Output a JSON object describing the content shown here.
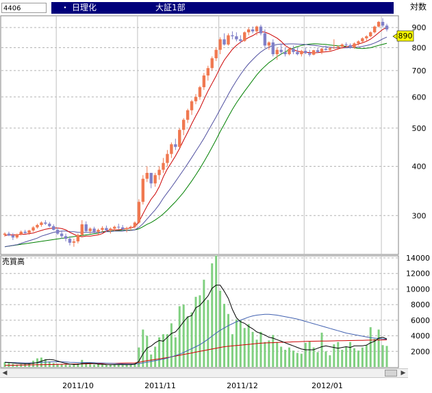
{
  "header": {
    "code": "4406",
    "bullet": "・",
    "company": "日理化",
    "market": "大証1部",
    "period": "対数"
  },
  "price_panel": {
    "current_price": "890",
    "y_ticks": [
      "900",
      "800",
      "700",
      "600",
      "500",
      "400",
      "300"
    ]
  },
  "volume_panel": {
    "label": "売買高",
    "y_ticks": [
      "14000",
      "12000",
      "10000",
      "8000",
      "6000",
      "4000",
      "2000"
    ]
  },
  "x_ticks": [
    "2011/10",
    "2011/11",
    "2011/12",
    "2012/01"
  ],
  "colors": {
    "up": "#f07850",
    "down": "#8080c8",
    "ma_short": "#cc0000",
    "ma_mid": "#5050a0",
    "ma_long": "#008000",
    "vol_bar": "#80d080",
    "vol_ma_short": "#000000",
    "vol_ma_mid": "#4060b0",
    "vol_ma_long": "#cc0000",
    "price_tag": "#ffff00"
  },
  "chart_data": {
    "type": "candlestick",
    "scale": "log",
    "x": [
      "2011-09-12",
      "2011-09-13",
      "2011-09-14",
      "2011-09-15",
      "2011-09-16",
      "2011-09-20",
      "2011-09-21",
      "2011-09-22",
      "2011-09-26",
      "2011-09-27",
      "2011-09-28",
      "2011-09-29",
      "2011-09-30",
      "2011-10-03",
      "2011-10-04",
      "2011-10-05",
      "2011-10-06",
      "2011-10-07",
      "2011-10-11",
      "2011-10-12",
      "2011-10-13",
      "2011-10-14",
      "2011-10-17",
      "2011-10-18",
      "2011-10-19",
      "2011-10-20",
      "2011-10-21",
      "2011-10-24",
      "2011-10-25",
      "2011-10-26",
      "2011-10-27",
      "2011-10-28",
      "2011-10-31",
      "2011-11-01",
      "2011-11-02",
      "2011-11-04",
      "2011-11-07",
      "2011-11-08",
      "2011-11-09",
      "2011-11-10",
      "2011-11-11",
      "2011-11-14",
      "2011-11-15",
      "2011-11-16",
      "2011-11-17",
      "2011-11-18",
      "2011-11-21",
      "2011-11-22",
      "2011-11-24",
      "2011-11-25",
      "2011-11-28",
      "2011-11-29",
      "2011-11-30",
      "2011-12-01",
      "2011-12-02",
      "2011-12-05",
      "2011-12-06",
      "2011-12-07",
      "2011-12-08",
      "2011-12-09",
      "2011-12-12",
      "2011-12-13",
      "2011-12-14",
      "2011-12-15",
      "2011-12-16",
      "2011-12-19",
      "2011-12-20",
      "2011-12-21",
      "2011-12-22",
      "2011-12-26",
      "2011-12-27",
      "2011-12-28",
      "2011-12-29",
      "2011-12-30",
      "2012-01-04",
      "2012-01-05",
      "2012-01-06",
      "2012-01-10",
      "2012-01-11",
      "2012-01-12",
      "2012-01-13",
      "2012-01-16",
      "2012-01-17",
      "2012-01-18",
      "2012-01-19",
      "2012-01-20",
      "2012-01-23",
      "2012-01-24",
      "2012-01-25",
      "2012-01-26",
      "2012-01-27",
      "2012-01-30",
      "2012-01-31",
      "2012-02-01",
      "2012-02-02"
    ],
    "ohlc": [
      [
        268,
        272,
        265,
        270
      ],
      [
        270,
        273,
        266,
        267
      ],
      [
        267,
        271,
        260,
        264
      ],
      [
        264,
        270,
        262,
        269
      ],
      [
        269,
        275,
        267,
        273
      ],
      [
        273,
        276,
        270,
        271
      ],
      [
        271,
        276,
        268,
        275
      ],
      [
        275,
        282,
        273,
        280
      ],
      [
        280,
        286,
        278,
        284
      ],
      [
        284,
        290,
        281,
        288
      ],
      [
        288,
        292,
        284,
        286
      ],
      [
        286,
        289,
        280,
        282
      ],
      [
        282,
        285,
        275,
        276
      ],
      [
        276,
        280,
        268,
        270
      ],
      [
        270,
        275,
        262,
        266
      ],
      [
        266,
        270,
        258,
        262
      ],
      [
        262,
        266,
        252,
        256
      ],
      [
        256,
        262,
        250,
        258
      ],
      [
        258,
        270,
        255,
        268
      ],
      [
        268,
        292,
        266,
        285
      ],
      [
        285,
        290,
        272,
        274
      ],
      [
        274,
        280,
        270,
        278
      ],
      [
        278,
        281,
        270,
        273
      ],
      [
        273,
        278,
        268,
        276
      ],
      [
        276,
        282,
        272,
        279
      ],
      [
        279,
        283,
        273,
        275
      ],
      [
        275,
        280,
        270,
        278
      ],
      [
        278,
        283,
        274,
        281
      ],
      [
        281,
        286,
        277,
        280
      ],
      [
        280,
        284,
        274,
        277
      ],
      [
        277,
        281,
        272,
        279
      ],
      [
        279,
        283,
        275,
        281
      ],
      [
        281,
        290,
        278,
        288
      ],
      [
        288,
        330,
        286,
        325
      ],
      [
        325,
        380,
        320,
        372
      ],
      [
        372,
        400,
        365,
        385
      ],
      [
        385,
        380,
        352,
        362
      ],
      [
        362,
        385,
        355,
        380
      ],
      [
        380,
        400,
        370,
        392
      ],
      [
        392,
        420,
        385,
        408
      ],
      [
        408,
        440,
        400,
        430
      ],
      [
        430,
        460,
        420,
        455
      ],
      [
        455,
        470,
        440,
        448
      ],
      [
        448,
        500,
        445,
        495
      ],
      [
        495,
        530,
        480,
        525
      ],
      [
        525,
        560,
        515,
        555
      ],
      [
        555,
        590,
        540,
        585
      ],
      [
        585,
        610,
        575,
        600
      ],
      [
        600,
        640,
        590,
        635
      ],
      [
        635,
        690,
        625,
        680
      ],
      [
        680,
        720,
        660,
        710
      ],
      [
        710,
        760,
        700,
        752
      ],
      [
        752,
        800,
        740,
        790
      ],
      [
        790,
        850,
        770,
        840
      ],
      [
        840,
        870,
        810,
        815
      ],
      [
        815,
        870,
        810,
        860
      ],
      [
        860,
        880,
        840,
        855
      ],
      [
        855,
        875,
        830,
        840
      ],
      [
        840,
        860,
        820,
        832
      ],
      [
        832,
        880,
        828,
        875
      ],
      [
        875,
        900,
        860,
        890
      ],
      [
        890,
        905,
        870,
        880
      ],
      [
        880,
        910,
        860,
        905
      ],
      [
        905,
        915,
        860,
        870
      ],
      [
        870,
        890,
        800,
        810
      ],
      [
        810,
        830,
        790,
        825
      ],
      [
        825,
        840,
        760,
        770
      ],
      [
        770,
        800,
        745,
        790
      ],
      [
        790,
        815,
        770,
        780
      ],
      [
        780,
        800,
        760,
        770
      ],
      [
        770,
        800,
        765,
        795
      ],
      [
        795,
        810,
        770,
        780
      ],
      [
        780,
        800,
        765,
        770
      ],
      [
        770,
        790,
        760,
        785
      ],
      [
        785,
        800,
        770,
        775
      ],
      [
        775,
        790,
        760,
        768
      ],
      [
        768,
        790,
        765,
        788
      ],
      [
        788,
        800,
        775,
        780
      ],
      [
        780,
        800,
        770,
        795
      ],
      [
        795,
        810,
        785,
        790
      ],
      [
        790,
        805,
        780,
        798
      ],
      [
        798,
        840,
        795,
        800
      ],
      [
        800,
        810,
        790,
        805
      ],
      [
        805,
        820,
        795,
        815
      ],
      [
        815,
        825,
        805,
        812
      ],
      [
        812,
        820,
        795,
        800
      ],
      [
        800,
        825,
        795,
        820
      ],
      [
        820,
        835,
        810,
        830
      ],
      [
        830,
        850,
        820,
        845
      ],
      [
        845,
        860,
        830,
        855
      ],
      [
        855,
        880,
        850,
        875
      ],
      [
        875,
        910,
        870,
        905
      ],
      [
        905,
        935,
        900,
        930
      ],
      [
        930,
        950,
        900,
        910
      ],
      [
        910,
        920,
        880,
        890
      ]
    ],
    "volume": [
      600,
      500,
      400,
      300,
      350,
      400,
      500,
      800,
      1100,
      1200,
      1000,
      700,
      500,
      400,
      350,
      300,
      250,
      300,
      450,
      900,
      400,
      350,
      300,
      350,
      300,
      250,
      300,
      350,
      300,
      250,
      300,
      350,
      500,
      2500,
      4800,
      4000,
      1600,
      2600,
      3800,
      4200,
      4200,
      5600,
      3800,
      7800,
      8000,
      6500,
      7000,
      9000,
      9200,
      11200,
      8600,
      13300,
      14300,
      9800,
      8100,
      6800,
      4200,
      6100,
      6000,
      5000,
      5500,
      4500,
      3500,
      4500,
      3200,
      3400,
      4100,
      3200,
      2600,
      2200,
      2500,
      2100,
      1800,
      1700,
      3100,
      3300,
      2500,
      1900,
      4400,
      2000,
      1500,
      2900,
      3200,
      2200,
      2600,
      3200,
      2400,
      2100,
      2500,
      2800,
      5100,
      3600,
      4800,
      2800,
      2700
    ],
    "ma": {
      "short": [
        267,
        268,
        268,
        268,
        269,
        269,
        270,
        271,
        273,
        275,
        277,
        278,
        279,
        279,
        278,
        276,
        272,
        269,
        266,
        265,
        266,
        266,
        267,
        268,
        270,
        274,
        276,
        276,
        276,
        277,
        278,
        279,
        281,
        289,
        303,
        317,
        330,
        340,
        355,
        376,
        394,
        409,
        425,
        444,
        466,
        488,
        513,
        537,
        561,
        591,
        621,
        649,
        678,
        713,
        744,
        768,
        792,
        811,
        826,
        837,
        849,
        858,
        871,
        878,
        876,
        868,
        857,
        846,
        830,
        810,
        798,
        790,
        784,
        780,
        778,
        778,
        776,
        777,
        779,
        781,
        783,
        788,
        795,
        800,
        804,
        807,
        811,
        817,
        823,
        830,
        841,
        856,
        873,
        890,
        900
      ],
      "mid": [
        250,
        251,
        252,
        253,
        255,
        257,
        259,
        261,
        263,
        266,
        268,
        270,
        272,
        273,
        274,
        274,
        273,
        273,
        272,
        272,
        272,
        272,
        272,
        272,
        272,
        273,
        273,
        274,
        274,
        274,
        275,
        275,
        276,
        280,
        286,
        294,
        302,
        310,
        320,
        332,
        343,
        354,
        366,
        379,
        392,
        406,
        421,
        437,
        453,
        471,
        491,
        512,
        534,
        558,
        583,
        609,
        635,
        660,
        684,
        707,
        728,
        746,
        764,
        780,
        793,
        803,
        810,
        815,
        817,
        817,
        818,
        818,
        817,
        816,
        815,
        813,
        811,
        809,
        806,
        804,
        802,
        800,
        799,
        799,
        799,
        800,
        801,
        803,
        806,
        810,
        815,
        822,
        831,
        842,
        851
      ]
    },
    "volume_ma": {
      "short": [
        600,
        560,
        520,
        470,
        440,
        410,
        420,
        480,
        560,
        740,
        900,
        960,
        900,
        760,
        600,
        460,
        360,
        320,
        330,
        440,
        460,
        480,
        440,
        360,
        340,
        300,
        290,
        300,
        300,
        300,
        290,
        300,
        340,
        740,
        1680,
        2420,
        2680,
        3100,
        3400,
        3300,
        3800,
        4300,
        4500,
        5100,
        5800,
        6400,
        6600,
        7600,
        7900,
        8500,
        9100,
        10100,
        10500,
        10500,
        9700,
        8800,
        7400,
        6300,
        5800,
        5600,
        5200,
        4900,
        4500,
        4300,
        4100,
        3800,
        3700,
        3500,
        3300,
        3100,
        2900,
        2700,
        2500,
        2300,
        2200,
        2200,
        2200,
        2400,
        2600,
        2700,
        2600,
        2500,
        2400,
        2500,
        2600,
        2500,
        2700,
        2700,
        2700,
        2800,
        3100,
        3300,
        3700,
        3800,
        3600
      ],
      "mid": [
        600,
        580,
        560,
        540,
        520,
        500,
        500,
        510,
        540,
        580,
        620,
        650,
        660,
        660,
        650,
        630,
        600,
        580,
        560,
        560,
        560,
        550,
        540,
        520,
        500,
        480,
        460,
        440,
        420,
        400,
        390,
        380,
        380,
        420,
        520,
        620,
        700,
        800,
        900,
        1000,
        1140,
        1300,
        1450,
        1650,
        1850,
        2100,
        2350,
        2600,
        2850,
        3200,
        3550,
        3950,
        4350,
        4700,
        5000,
        5300,
        5550,
        5800,
        6000,
        6200,
        6400,
        6550,
        6650,
        6700,
        6750,
        6750,
        6700,
        6650,
        6550,
        6450,
        6350,
        6250,
        6150,
        6000,
        5850,
        5700,
        5550,
        5400,
        5250,
        5100,
        4950,
        4800,
        4650,
        4500,
        4350,
        4250,
        4150,
        4050,
        3950,
        3850,
        3750,
        3700,
        3650,
        3600,
        3550
      ],
      "long": [
        200,
        210,
        220,
        230,
        240,
        250,
        260,
        270,
        280,
        290,
        300,
        310,
        320,
        330,
        340,
        350,
        360,
        370,
        380,
        390,
        400,
        410,
        420,
        430,
        440,
        450,
        460,
        470,
        480,
        490,
        500,
        510,
        520,
        600,
        700,
        800,
        880,
        960,
        1040,
        1120,
        1200,
        1300,
        1400,
        1500,
        1600,
        1700,
        1800,
        1900,
        2000,
        2100,
        2200,
        2300,
        2400,
        2500,
        2600,
        2650,
        2700,
        2750,
        2800,
        2850,
        2900,
        2950,
        3000,
        3050,
        3080,
        3100,
        3120,
        3140,
        3160,
        3180,
        3200,
        3220,
        3240,
        3260,
        3280,
        3290,
        3300,
        3310,
        3320,
        3330,
        3340,
        3350,
        3360,
        3370,
        3380,
        3390,
        3400,
        3410,
        3420,
        3430,
        3440,
        3450,
        3460,
        3470,
        3480
      ]
    },
    "price_range": [
      240,
      960
    ],
    "volume_range": [
      0,
      14000
    ],
    "grid": true
  }
}
